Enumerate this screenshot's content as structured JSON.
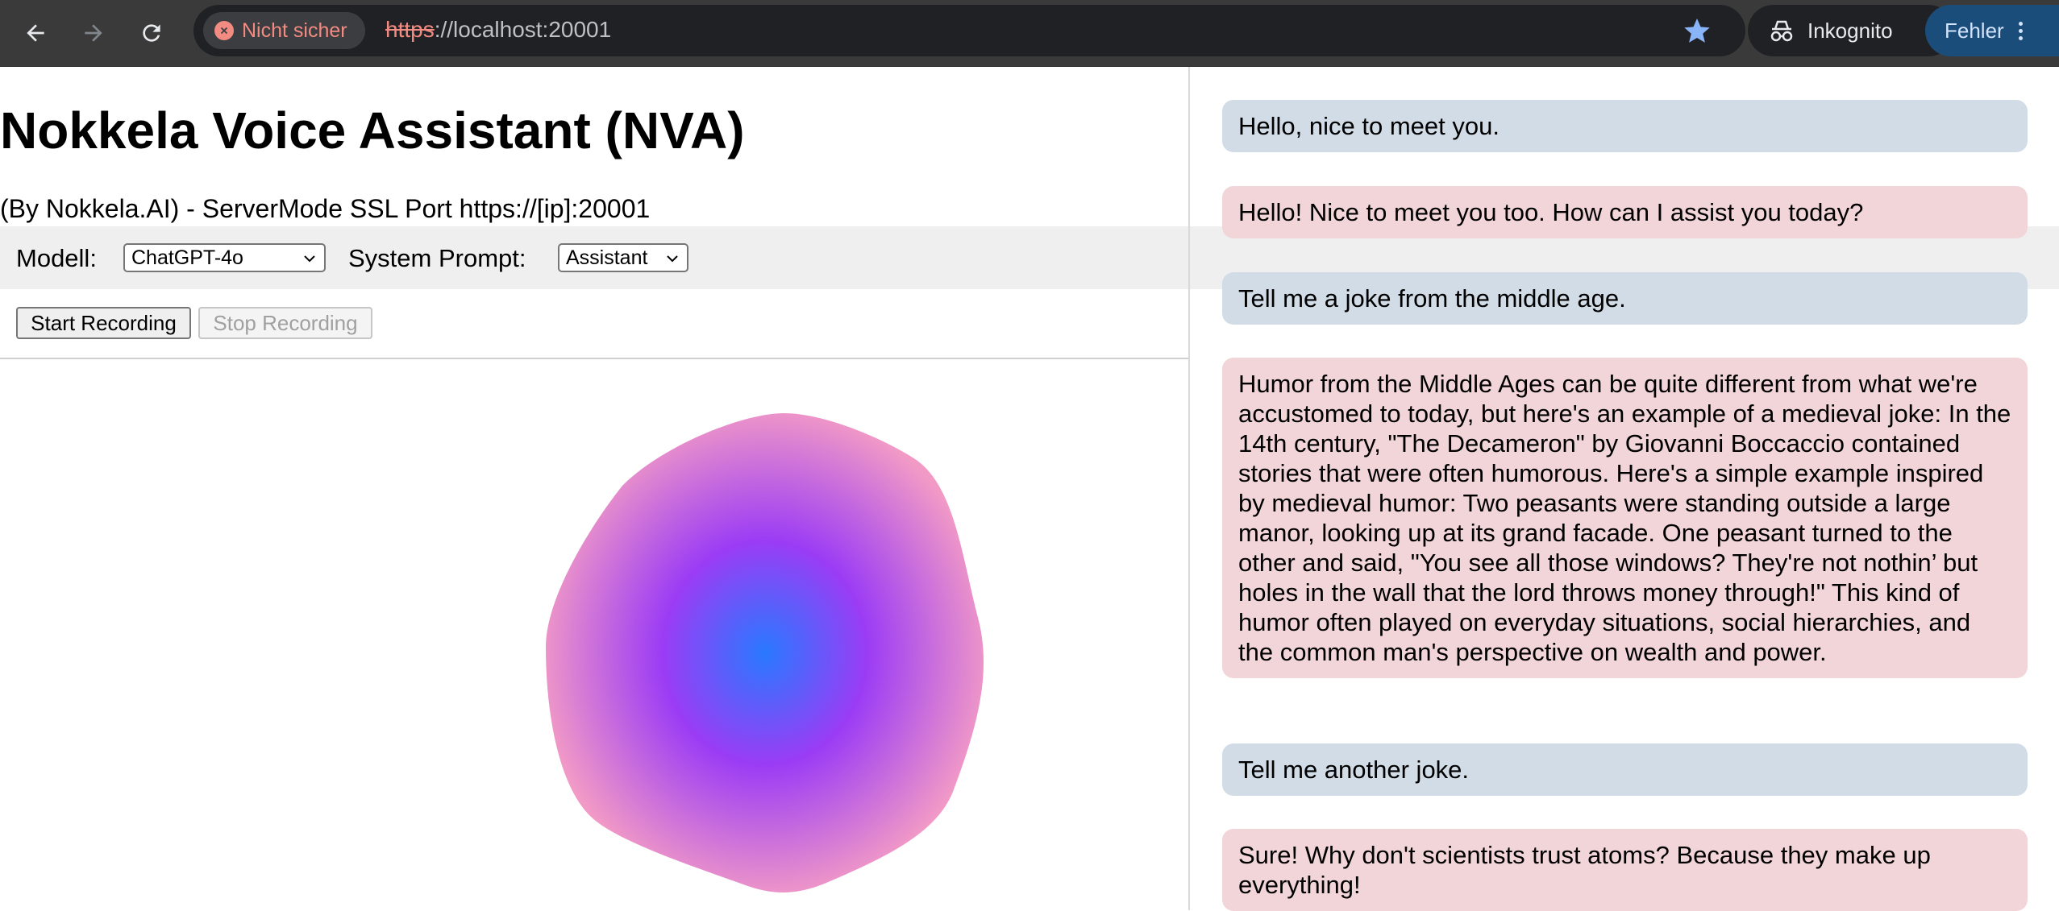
{
  "browser": {
    "security_label": "Nicht sicher",
    "url_scheme": "https",
    "url_rest": "://localhost:20001",
    "incognito_label": "Inkognito",
    "error_label": "Fehler"
  },
  "page": {
    "title": "Nokkela Voice Assistant (NVA)",
    "subtitle": "(By Nokkela.AI) - ServerMode SSL Port https://[ip]:20001"
  },
  "controls": {
    "model_label": "Modell:",
    "model_value": "ChatGPT-4o",
    "prompt_label": "System Prompt:",
    "prompt_value": "Assistant",
    "start_label": "Start Recording",
    "stop_label": "Stop Recording"
  },
  "visualizer": {
    "center_color": "#2979ff",
    "mid_color": "#9b3cf5",
    "outer_color": "#f29ac6"
  },
  "chat": {
    "messages": [
      {
        "role": "user",
        "text": "Hello, nice to meet you."
      },
      {
        "role": "assistant",
        "text": "Hello! Nice to meet you too. How can I assist you today?"
      },
      {
        "role": "user",
        "text": "Tell me a joke from the middle age."
      },
      {
        "role": "assistant",
        "text": "Humor from the Middle Ages can be quite different from what we're accustomed to today, but here's an example of a medieval joke: In the 14th century, \"The Decameron\" by Giovanni Boccaccio contained stories that were often humorous. Here's a simple example inspired by medieval humor: Two peasants were standing outside a large manor, looking up at its grand facade. One peasant turned to the other and said, \"You see all those windows? They're not nothin’ but holes in the wall that the lord throws money through!\" This kind of humor often played on everyday situations, social hierarchies, and the common man's perspective on wealth and power."
      },
      {
        "role": "user",
        "text": "Tell me another joke."
      },
      {
        "role": "assistant",
        "text": "Sure! Why don't scientists trust atoms? Because they make up everything!"
      }
    ]
  },
  "colors": {
    "user_bubble": "#d1dce6",
    "assistant_bubble": "#f1d5d8",
    "chrome_bg": "#3a3a3a",
    "warning": "#f28b82",
    "star": "#8ab4f8"
  }
}
